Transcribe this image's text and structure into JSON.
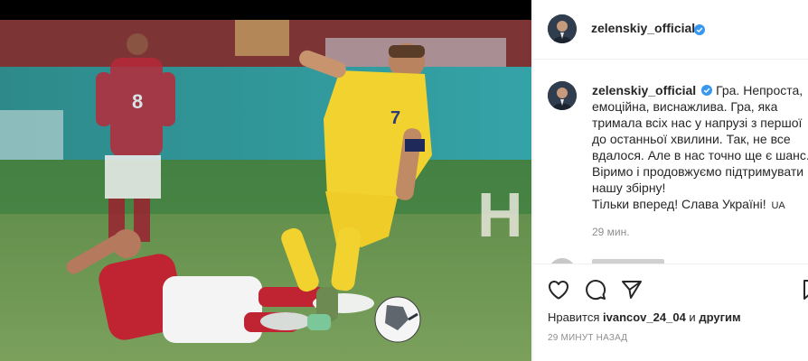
{
  "post": {
    "username": "zelenskiy_official",
    "verified_icon": "verified-badge-icon",
    "caption_lines": [
      "Гра. Непроста,",
      "емоційна, виснажлива. Гра, яка",
      "тримала всіх нас у напрузі з першої",
      "до останньої хвилини. Так, не все",
      "вдалося. Але в нас точно ще є шанс.",
      "Віримо і продовжуємо підтримувати",
      "нашу збірну!",
      "Тільки вперед! Слава Україні!"
    ],
    "caption_flag": "UA",
    "comment_time": "29 мин.",
    "more_icon": "more-options-icon"
  },
  "actions": {
    "like_icon": "heart-icon",
    "comment_icon": "comment-bubble-icon",
    "share_icon": "paper-plane-icon",
    "save_icon": "bookmark-icon"
  },
  "likes": {
    "prefix": "Нравится",
    "user": "ivancov_24_04",
    "connector": "и",
    "others": "другим"
  },
  "timestamp": "29 МИНУТ НАЗАД",
  "colors": {
    "text": "#262626",
    "muted": "#8e8e8e",
    "verified": "#3897f0",
    "divider": "#efefef",
    "jersey_yellow": "#f2d22e",
    "jersey_red": "#c9202c"
  }
}
